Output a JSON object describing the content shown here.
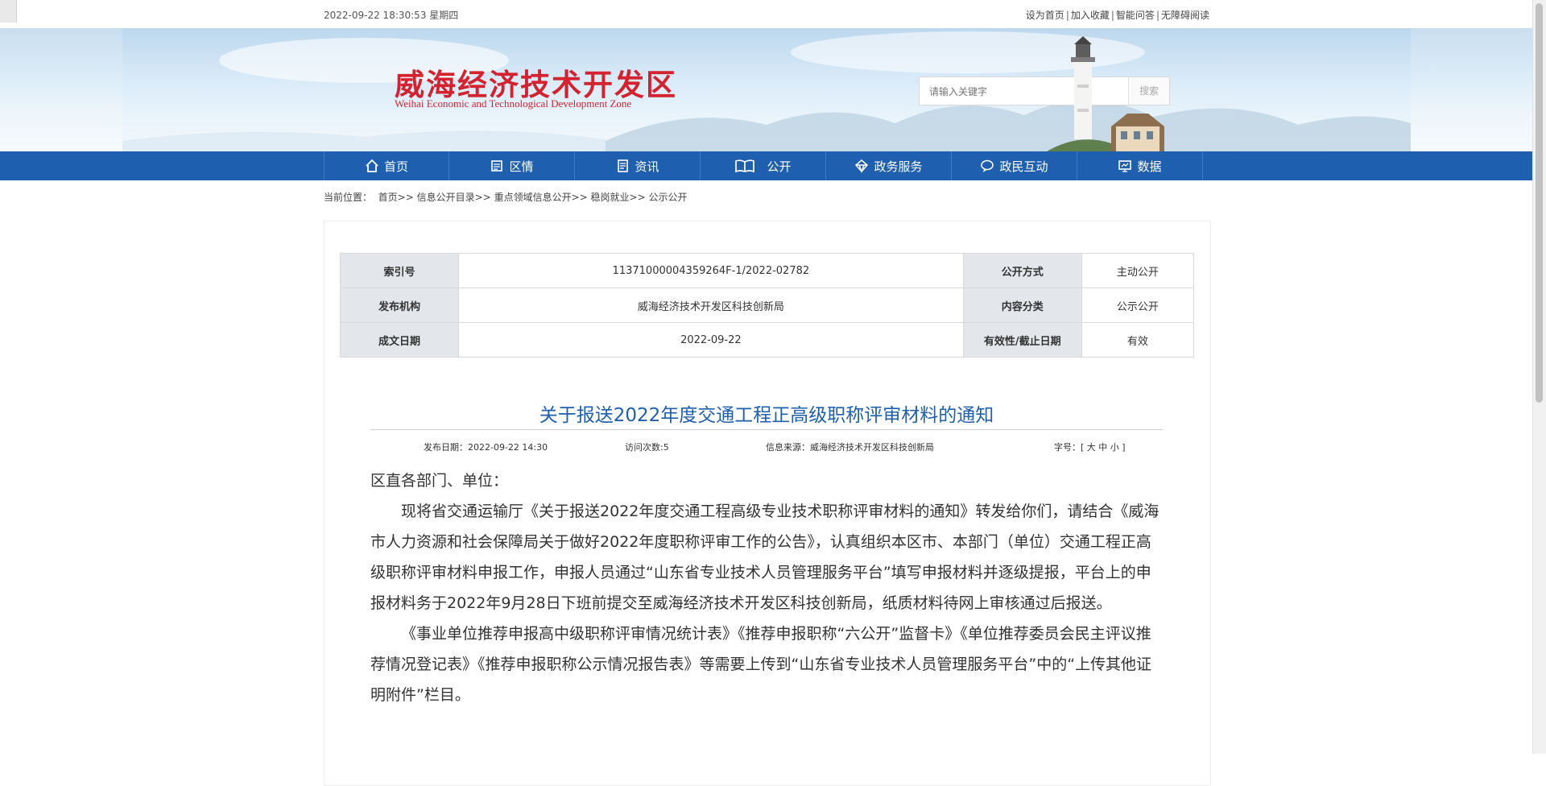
{
  "topbar": {
    "datetime": "2022-09-22 18:30:53 星期四",
    "links": [
      "设为首页",
      "加入收藏",
      "智能问答",
      "无障碍阅读"
    ]
  },
  "header": {
    "logo_cn": "威海经济技术开发区",
    "logo_en": "Weihai Economic and Technological Development Zone",
    "search_placeholder": "请输入关键字",
    "search_button": "搜索"
  },
  "nav": {
    "items": [
      {
        "label": "首页",
        "icon": "home-icon"
      },
      {
        "label": "区情",
        "icon": "news-paper-icon"
      },
      {
        "label": "资讯",
        "icon": "document-icon"
      },
      {
        "label": "公开",
        "icon": "book-icon"
      },
      {
        "label": "政务服务",
        "icon": "diamond-icon"
      },
      {
        "label": "政民互动",
        "icon": "chat-icon"
      },
      {
        "label": "数据",
        "icon": "monitor-icon"
      }
    ]
  },
  "breadcrumb": {
    "prefix": "当前位置：",
    "items": [
      "首页",
      "信息公开目录",
      "重点领域信息公开",
      "稳岗就业",
      "公示公开"
    ],
    "sep": ">>"
  },
  "meta_table": {
    "rows": [
      [
        {
          "k": "索引号",
          "v": "11371000004359264F-1/2022-02782"
        },
        {
          "k": "公开方式",
          "v": "主动公开"
        }
      ],
      [
        {
          "k": "发布机构",
          "v": "威海经济技术开发区科技创新局"
        },
        {
          "k": "内容分类",
          "v": "公示公开"
        }
      ],
      [
        {
          "k": "成文日期",
          "v": "2022-09-22"
        },
        {
          "k": "有效性/截止日期",
          "v": "有效"
        }
      ]
    ]
  },
  "article": {
    "title": "关于报送2022年度交通工程正高级职称评审材料的通知",
    "publish_date": "发布日期：2022-09-22 14:30",
    "visits": "访问次数:5",
    "source": "信息来源：威海经济技术开发区科技创新局",
    "font_size_label": "字号：[ 大 中 小 ]",
    "paragraphs": [
      "区直各部门、单位：",
      "现将省交通运输厅《关于报送2022年度交通工程高级专业技术职称评审材料的通知》转发给你们，请结合《威海市人力资源和社会保障局关于做好2022年度职称评审工作的公告》，认真组织本区市、本部门（单位）交通工程正高级职称评审材料申报工作，申报人员通过“山东省专业技术人员管理服务平台”填写申报材料并逐级提报，平台上的申报材料务于2022年9月28日下班前提交至威海经济技术开发区科技创新局，纸质材料待网上审核通过后报送。",
      "《事业单位推荐申报高中级职称评审情况统计表》《推荐申报职称“六公开”监督卡》《单位推荐委员会民主评议推荐情况登记表》《推荐申报职称公示情况报告表》等需要上传到“山东省专业技术人员管理服务平台”中的“上传其他证明附件”栏目。"
    ]
  }
}
